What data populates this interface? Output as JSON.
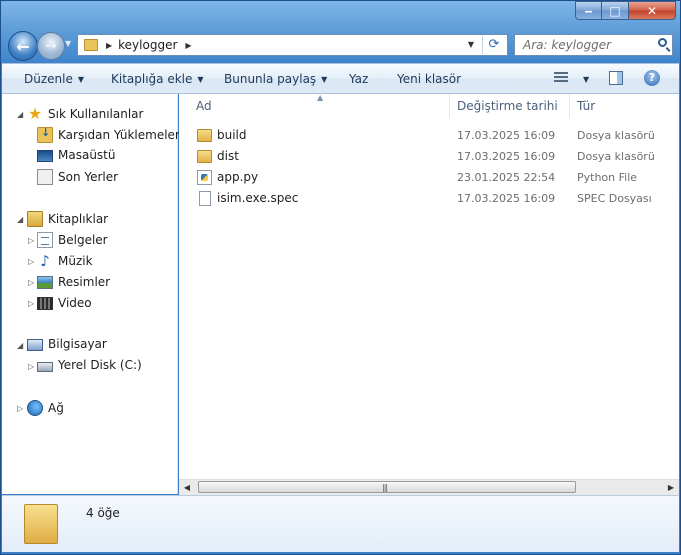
{
  "window": {
    "minimize_glyph": "‒",
    "maximize_glyph": "□",
    "close_glyph": "✕"
  },
  "address_bar": {
    "path": "keylogger",
    "search_placeholder": "Ara: keylogger"
  },
  "command_bar": {
    "organize": "Düzenle",
    "add_to_library": "Kitaplığa ekle",
    "share_with": "Bununla paylaş",
    "burn": "Yaz",
    "new_folder": "Yeni klasör",
    "help": "?"
  },
  "nav_pane": {
    "favorites": {
      "title": "Sık Kullanılanlar",
      "items": [
        "Karşıdan Yüklemeler",
        "Masaüstü",
        "Son Yerler"
      ]
    },
    "libraries": {
      "title": "Kitaplıklar",
      "items": [
        "Belgeler",
        "Müzik",
        "Resimler",
        "Video"
      ]
    },
    "computer": {
      "title": "Bilgisayar",
      "items": [
        "Yerel Disk (C:)"
      ]
    },
    "network": {
      "title": "Ağ"
    }
  },
  "columns": {
    "name": "Ad",
    "date_modified": "Değiştirme tarihi",
    "type": "Tür"
  },
  "files": [
    {
      "name": "build",
      "date": "17.03.2025 16:09",
      "type": "Dosya klasörü",
      "icon": "folder-icon"
    },
    {
      "name": "dist",
      "date": "17.03.2025 16:09",
      "type": "Dosya klasörü",
      "icon": "folder-icon"
    },
    {
      "name": "app.py",
      "date": "23.01.2025 22:54",
      "type": "Python File",
      "icon": "python-file-icon"
    },
    {
      "name": "isim.exe.spec",
      "date": "17.03.2025 16:09",
      "type": "SPEC Dosyası",
      "icon": "file-icon"
    }
  ],
  "details_pane": {
    "count": "4 öğe"
  }
}
